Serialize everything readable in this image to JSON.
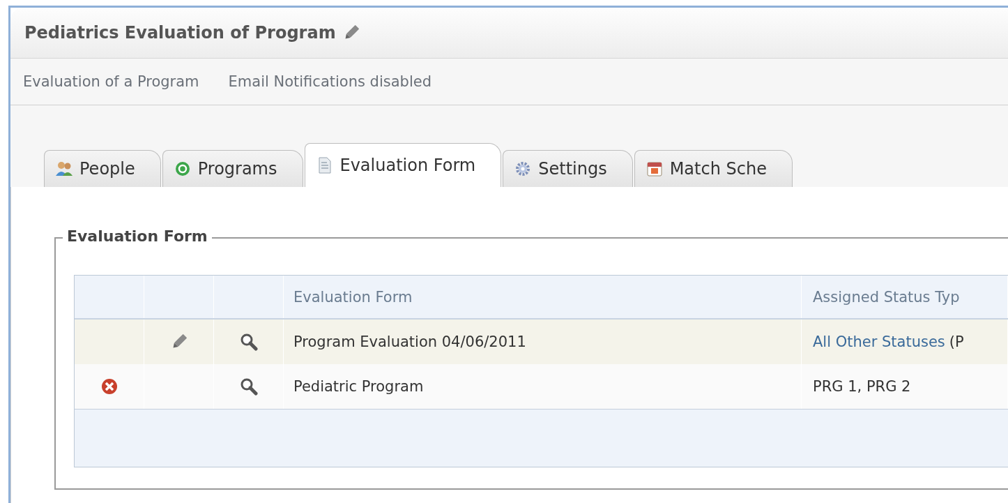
{
  "header": {
    "title": "Pediatrics Evaluation of Program",
    "subtitle_items": [
      "Evaluation of a Program",
      "Email Notifications disabled"
    ]
  },
  "tabs": [
    {
      "label": "People",
      "selected": false
    },
    {
      "label": "Programs",
      "selected": false
    },
    {
      "label": "Evaluation Form",
      "selected": true
    },
    {
      "label": "Settings",
      "selected": false
    },
    {
      "label": "Match Sche",
      "selected": false
    }
  ],
  "section": {
    "legend": "Evaluation Form",
    "table": {
      "columns": [
        "Evaluation Form",
        "Assigned Status Typ"
      ],
      "rows": [
        {
          "can_delete": false,
          "can_edit": true,
          "can_view": true,
          "highlighted": true,
          "form": "Program Evaluation 04/06/2011",
          "assigned_link": "All Other Statuses",
          "assigned_text": "(P"
        },
        {
          "can_delete": true,
          "can_edit": false,
          "can_view": true,
          "highlighted": false,
          "form": "Pediatric Program",
          "assigned_text": "PRG 1, PRG 2"
        }
      ]
    }
  }
}
